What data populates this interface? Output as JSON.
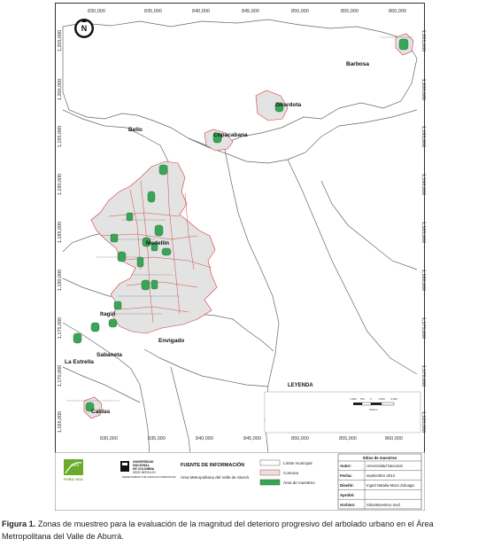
{
  "map": {
    "easting_ticks": [
      "830,000",
      "835,000",
      "840,000",
      "845,000",
      "850,000",
      "855,000",
      "860,000"
    ],
    "northing_ticks": [
      "1,205,000",
      "1,200,000",
      "1,195,000",
      "1,190,000",
      "1,185,000",
      "1,180,000",
      "1,175,000",
      "1,170,000",
      "1,165,000"
    ],
    "north_symbol": "N",
    "places": {
      "barbosa": "Barbosa",
      "girardota": "Girardota",
      "copacabana": "Copacabana",
      "bello": "Bello",
      "medellin": "Medellín",
      "itagui": "Itagüí",
      "envigado": "Envigado",
      "sabaneta": "Sabaneta",
      "la_estrella": "La Estrella",
      "caldas": "Caldas"
    },
    "sample_area_color": "#3aa556",
    "comuna_fill_color": "#e3e3e3",
    "boundary_color": "#d23a3a",
    "scale_bar": {
      "labels": [
        "1,000",
        "750",
        "0",
        "1,500",
        "3,000"
      ],
      "unit": "Metros"
    }
  },
  "legend": {
    "title": "LEYENDA",
    "items": [
      "Límite municipal",
      "Comuna",
      "Área de muestreo"
    ]
  },
  "logos": {
    "area_logo_text": "Área",
    "area_logo_subtext": "PURA VIDA",
    "university_line1": "UNIVERSIDAD",
    "university_line2": "NACIONAL",
    "university_line3": "DE COLOMBIA",
    "university_line4": "SEDE MEDELLÍN",
    "university_line5": "DEPARTAMENTO DE CIENCIAS FORESTALES"
  },
  "source": {
    "title": "FUENTE DE INFORMACIÓN",
    "text": "Área Metropolitana del Valle de Aburrá"
  },
  "title_block": {
    "header": "Sitios de muestreo",
    "rows": [
      {
        "label": "Autor:",
        "value": "Universidad Nacional"
      },
      {
        "label": "Fecha:",
        "value": "septiembre 2013"
      },
      {
        "label": "Diseñó:",
        "value": "Ingrid Natalia Mazo Zuluaga"
      },
      {
        "label": "Aprobó:",
        "value": ""
      },
      {
        "label": "Archivo:",
        "value": "SitiosMuestreo.mxd"
      }
    ]
  },
  "caption": {
    "label": "Figura 1.",
    "text": " Zonas de muestreo para la evaluación de la magnitud del deterioro progresivo del arbolado urbano en el Área Metropolitana del Valle de Aburrá."
  }
}
